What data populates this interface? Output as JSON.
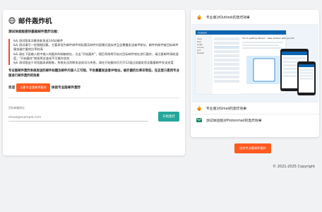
{
  "left": {
    "title": "邮件轰炸机",
    "subtitle": "测试体验版提供基础邮件轰炸功能：",
    "steps": [
      "&& 测试版本次最多能发送144封邮件",
      "&& 测试填写一些限制因素，主要表现为邮件邮件的标题及邮件内容模式类似并且会暴露发送者IP地址，邮件的邮件被目标邮件服务器拦截的比率较高",
      "&& 请在下面输入框中输入待轰炸的邮箱地址，点击\"开始轰炸\"，随后系统将开始对目标邮件地址进行轰炸，请注意邮件接收速度，\"开始轰炸\"按钮将会变成不可操作状态",
      "&& 测试版由于浏览器本调限制，系统无法判断发送成功与失败，请在开始轰炸后打开12道过滤器发验证看看邮件发送进度"
    ],
    "warning": "专业版邮件轰炸系统发送的邮件标题及邮件内容人工可视，不会暴露发送者IP地址，被拦截的比率非常低，在这里只是用专业版进行邮件轰炸的效果",
    "welcome_prefix": "欢迎",
    "welcome_button": "注册专业版邮件轰炸",
    "welcome_suffix": "体验专业版邮件轰炸",
    "email_label": "目标邮箱地址：",
    "email_placeholder": "email@example.com",
    "start_button": "开始轰炸"
  },
  "right": {
    "outlook_label": "专业版对Outlook的轰炸效果",
    "gmail_label": "专业版对Gmail的轰炸效果",
    "protonmail_label": "测试体验版对Protonmail的轰炸效果",
    "register_button": "注册专业版邮件轰炸"
  },
  "preview": {
    "folders": [
      "Inbox",
      "Sent",
      "Drafts",
      "Archive",
      "Junk",
      "Deleted"
    ],
    "headline": "You're getting deliveri - take Outlook with you for",
    "brand": "Outlook"
  },
  "footer": {
    "copyright": "© 2021-2025 Copyright"
  },
  "colors": {
    "accent_orange": "#ff5a1f",
    "accent_teal": "#26a69a",
    "step_border": "#e84b3a",
    "outlook_blue": "#0a64b0"
  }
}
